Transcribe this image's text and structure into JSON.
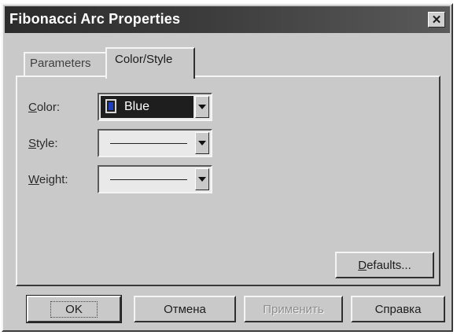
{
  "window": {
    "title": "Fibonacci Arc Properties",
    "close_glyph": "✕"
  },
  "tabs": [
    {
      "label": "Parameters",
      "active": false
    },
    {
      "label": "Color/Style",
      "active": true
    }
  ],
  "fields": {
    "color": {
      "label_key": "C",
      "label_rest": "olor:",
      "value": "Blue",
      "swatch_color": "#1f3fbf"
    },
    "style": {
      "label_key": "S",
      "label_rest": "tyle:",
      "value": "solid line"
    },
    "weight": {
      "label_key": "W",
      "label_rest": "eight:",
      "value": "thin line"
    }
  },
  "buttons": {
    "defaults_key": "D",
    "defaults_rest": "efaults...",
    "ok": "OK",
    "cancel": "Отмена",
    "apply": "Применить",
    "help": "Справка"
  },
  "colors": {
    "dialog_face": "#c9c9c9",
    "title_bar": "#2c2c2c",
    "selection": "#1e1e1e"
  }
}
